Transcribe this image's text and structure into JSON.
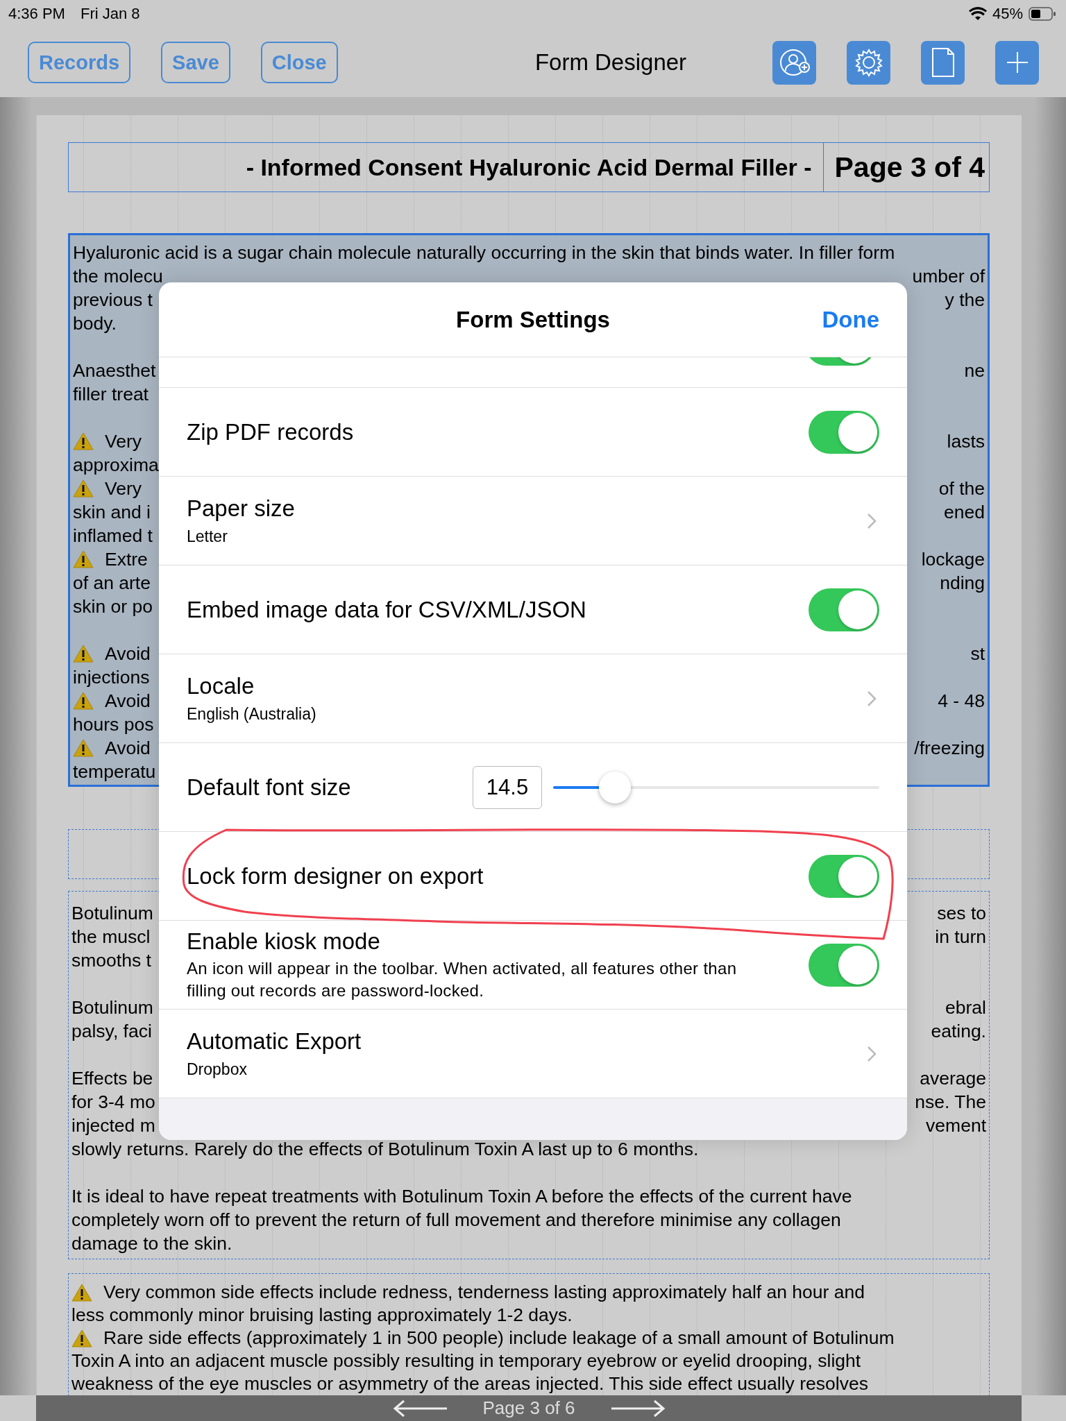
{
  "status_bar": {
    "time": "4:36 PM",
    "date": "Fri Jan 8",
    "battery": "45%"
  },
  "toolbar": {
    "buttons": [
      "Records",
      "Save",
      "Close"
    ],
    "title": "Form Designer"
  },
  "document": {
    "header": {
      "title": "- Informed Consent Hyaluronic Acid Dermal Filler -",
      "page": "Page 3 of 4"
    },
    "blocks": [
      {
        "selected": true,
        "paragraphs": [
          [
            {
              "left": "Hyaluronic acid is a sugar chain molecule naturally occurring in the skin that binds water. In filler form"
            },
            {
              "left": "the molecu",
              "right": "umber of"
            },
            {
              "left": "previous t",
              "right": "y the"
            },
            {
              "left": "body."
            }
          ],
          [
            {
              "left": "Anaesthet",
              "right": "ne"
            },
            {
              "left": "filler treat"
            }
          ],
          [
            {
              "warn": true,
              "left": "Very",
              "right": "lasts"
            },
            {
              "left": "approxima"
            },
            {
              "warn": true,
              "left": "Very",
              "right": "of the"
            },
            {
              "left": "skin and i",
              "right": "ened"
            },
            {
              "left": "inflamed t"
            },
            {
              "warn": true,
              "left": "Extre",
              "right": "lockage"
            },
            {
              "left": "of an arte",
              "right": "nding"
            },
            {
              "left": "skin or po"
            }
          ],
          [
            {
              "warn": true,
              "left": "Avoid",
              "right": "st"
            },
            {
              "left": "injections"
            },
            {
              "warn": true,
              "left": "Avoid",
              "right": "4 - 48"
            },
            {
              "left": "hours pos"
            },
            {
              "warn": true,
              "left": "Avoid",
              "right": "/freezing"
            },
            {
              "left": "temperatu"
            }
          ]
        ]
      },
      {
        "selected": false
      },
      {
        "selected": false,
        "paragraphs": [
          [
            {
              "left": "Botulinum",
              "right": "ses to"
            },
            {
              "left": "the muscl",
              "right": "in turn"
            },
            {
              "left": "smooths t"
            }
          ],
          [
            {
              "left": "Botulinum",
              "right": "ebral"
            },
            {
              "left": "palsy, faci",
              "right": "eating."
            }
          ],
          [
            {
              "left": "Effects be",
              "right": "average"
            },
            {
              "left": "for 3-4 mo",
              "right": "nse. The"
            },
            {
              "left": "injected m",
              "right": "vement"
            },
            {
              "left": "slowly returns. Rarely do the effects of Botulinum Toxin A last up to 6 months."
            }
          ],
          [
            {
              "left": "It is ideal to have repeat treatments with Botulinum Toxin A before the effects of the current have"
            },
            {
              "left": "completely worn off to prevent the return of full movement and therefore minimise any collagen"
            },
            {
              "left": "damage to the skin."
            }
          ]
        ]
      },
      {
        "selected": false,
        "paragraphs": [
          [
            {
              "warn": true,
              "left": "Very common side effects include redness, tenderness lasting approximately half an hour and"
            },
            {
              "left": "less commonly minor bruising lasting approximately 1-2 days."
            },
            {
              "warn": true,
              "left": "Rare side effects (approximately 1 in 500 people) include leakage of a small amount of Botulinum"
            },
            {
              "left": "Toxin A into an adjacent muscle possibly resulting in temporary eyebrow or eyelid drooping, slight"
            },
            {
              "left": "weakness of the eye muscles or asymmetry of the areas injected. This side effect usually resolves"
            }
          ]
        ]
      }
    ],
    "pager": "Page 3 of 6"
  },
  "dialog": {
    "title": "Form Settings",
    "done": "Done",
    "rows": [
      {
        "kind": "sliver",
        "on": true
      },
      {
        "kind": "toggle",
        "label": "Zip PDF records",
        "on": true
      },
      {
        "kind": "link",
        "label": "Paper size",
        "value": "Letter"
      },
      {
        "kind": "toggle",
        "label": "Embed image data for CSV/XML/JSON",
        "on": true
      },
      {
        "kind": "link",
        "label": "Locale",
        "value": "English (Australia)"
      },
      {
        "kind": "slider",
        "label": "Default font size",
        "value": "14.5",
        "level": 0.19
      },
      {
        "kind": "toggle",
        "label": "Lock form designer on export",
        "on": true,
        "annotated": true
      },
      {
        "kind": "toggle",
        "label": "Enable kiosk mode",
        "description": "An icon will appear in the toolbar. When activated, all features other than filling out records are password-locked.",
        "on": true
      },
      {
        "kind": "link",
        "label": "Automatic Export",
        "value": "Dropbox"
      }
    ]
  }
}
